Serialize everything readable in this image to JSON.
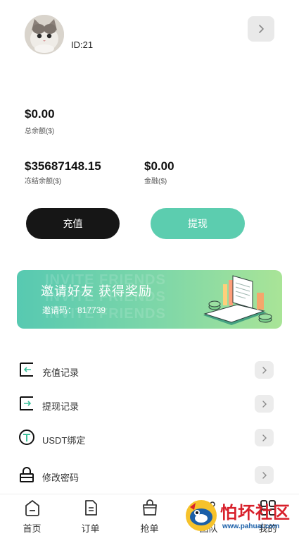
{
  "user": {
    "id_text": "ID:21"
  },
  "balances": {
    "total_value": "$0.00",
    "total_label": "总余额($)",
    "frozen_value": "$35687148.15",
    "frozen_label": "冻结余额($)",
    "finance_value": "$0.00",
    "finance_label": "金融($)"
  },
  "actions": {
    "recharge_label": "充值",
    "withdraw_label": "提现"
  },
  "banner": {
    "title": "邀请好友 获得奖励",
    "code_label": "邀请码：",
    "code_value": "817739",
    "bg_text_1": "INVITE FRIENDS",
    "bg_text_2": "INVITE FRIENDS",
    "bg_text_3": "INVITE FRIENDS"
  },
  "menu": {
    "items": [
      {
        "label": "充值记录",
        "icon": "recharge-record-icon"
      },
      {
        "label": "提现记录",
        "icon": "withdraw-record-icon"
      },
      {
        "label": "USDT绑定",
        "icon": "usdt-icon"
      },
      {
        "label": "修改密码",
        "icon": "lock-icon"
      }
    ]
  },
  "tabbar": {
    "items": [
      {
        "label": "首页",
        "icon": "home-icon"
      },
      {
        "label": "订单",
        "icon": "order-icon"
      },
      {
        "label": "抢单",
        "icon": "bag-icon"
      },
      {
        "label": "团队",
        "icon": "team-icon"
      },
      {
        "label": "我的",
        "icon": "grid-icon"
      }
    ]
  },
  "watermark": {
    "text": "怕坏社区",
    "url": "www.pahuai.com"
  },
  "colors": {
    "accent": "#5ccdaf",
    "dark_button": "#161616",
    "banner_start": "#57c9b1",
    "banner_end": "#a9e497"
  }
}
